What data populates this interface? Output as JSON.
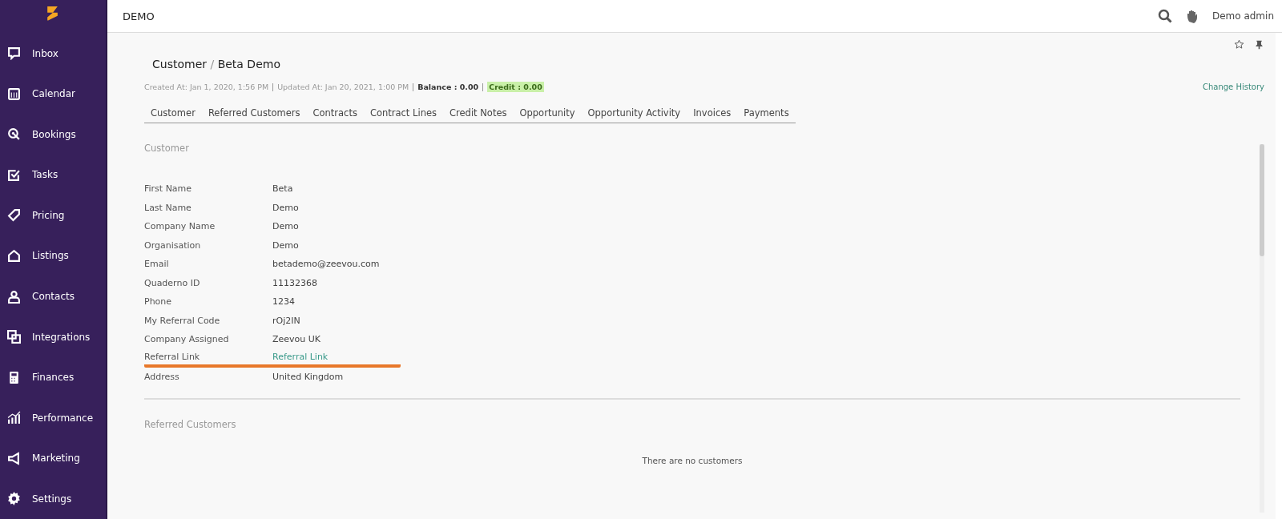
{
  "sidebar": {
    "items": [
      {
        "label": "Inbox",
        "kind": "inbox",
        "selected": false
      },
      {
        "label": "Calendar",
        "kind": "calendar",
        "selected": false
      },
      {
        "label": "Bookings",
        "kind": "bookings",
        "selected": false
      },
      {
        "label": "Tasks",
        "kind": "tasks",
        "selected": false
      },
      {
        "label": "Pricing",
        "kind": "pricing",
        "selected": false
      },
      {
        "label": "Listings",
        "kind": "listings",
        "selected": false
      },
      {
        "label": "Contacts",
        "kind": "contacts",
        "selected": false
      },
      {
        "label": "Integrations",
        "kind": "integrations",
        "selected": false
      },
      {
        "label": "Finances",
        "kind": "finances",
        "selected": false
      },
      {
        "label": "Performance",
        "kind": "performance",
        "selected": false
      },
      {
        "label": "Marketing",
        "kind": "marketing",
        "selected": false
      },
      {
        "label": "Settings",
        "kind": "settings",
        "selected": false
      }
    ]
  },
  "header": {
    "title": "DEMO",
    "user": "Demo admin"
  },
  "breadcrumb": {
    "section": "Customer",
    "separator": "/",
    "record": "Beta Demo"
  },
  "meta": {
    "created": "Created At: Jan 1, 2020, 1:56 PM",
    "updated": "Updated At: Jan 20, 2021, 1:00 PM",
    "balance": "Balance : 0.00",
    "credit": "Credit : 0.00",
    "change_history": "Change History"
  },
  "tabs": [
    {
      "label": "Customer",
      "selected": false
    },
    {
      "label": "Referred Customers",
      "selected": false
    },
    {
      "label": "Contracts",
      "selected": false
    },
    {
      "label": "Contract Lines",
      "selected": false
    },
    {
      "label": "Credit Notes",
      "selected": false
    },
    {
      "label": "Opportunity",
      "selected": false
    },
    {
      "label": "Opportunity Activity",
      "selected": false
    },
    {
      "label": "Invoices",
      "selected": false
    },
    {
      "label": "Payments",
      "selected": false
    }
  ],
  "customer_section": {
    "heading": "Customer",
    "fields": [
      {
        "label": "First Name",
        "value": "Beta",
        "kind": "text",
        "highlighted": false
      },
      {
        "label": "Last Name",
        "value": "Demo",
        "kind": "text",
        "highlighted": false
      },
      {
        "label": "Company Name",
        "value": "Demo",
        "kind": "text",
        "highlighted": false
      },
      {
        "label": "Organisation",
        "value": "Demo",
        "kind": "text",
        "highlighted": false
      },
      {
        "label": "Email",
        "value": "betademo@zeevou.com",
        "kind": "text",
        "highlighted": false
      },
      {
        "label": "Quaderno ID",
        "value": "11132368",
        "kind": "text",
        "highlighted": false
      },
      {
        "label": "Phone",
        "value": "1234",
        "kind": "text",
        "highlighted": false
      },
      {
        "label": "My Referral Code",
        "value": "rOj2IN",
        "kind": "text",
        "highlighted": false
      },
      {
        "label": "Company Assigned",
        "value": "Zeevou UK",
        "kind": "text",
        "highlighted": false
      },
      {
        "label": "Referral Link",
        "value": "Referral Link",
        "kind": "link",
        "highlighted": true
      },
      {
        "label": "Address",
        "value": "United Kingdom",
        "kind": "text",
        "highlighted": false
      }
    ]
  },
  "referred_section": {
    "heading": "Referred Customers",
    "empty_message": "There are no customers"
  }
}
